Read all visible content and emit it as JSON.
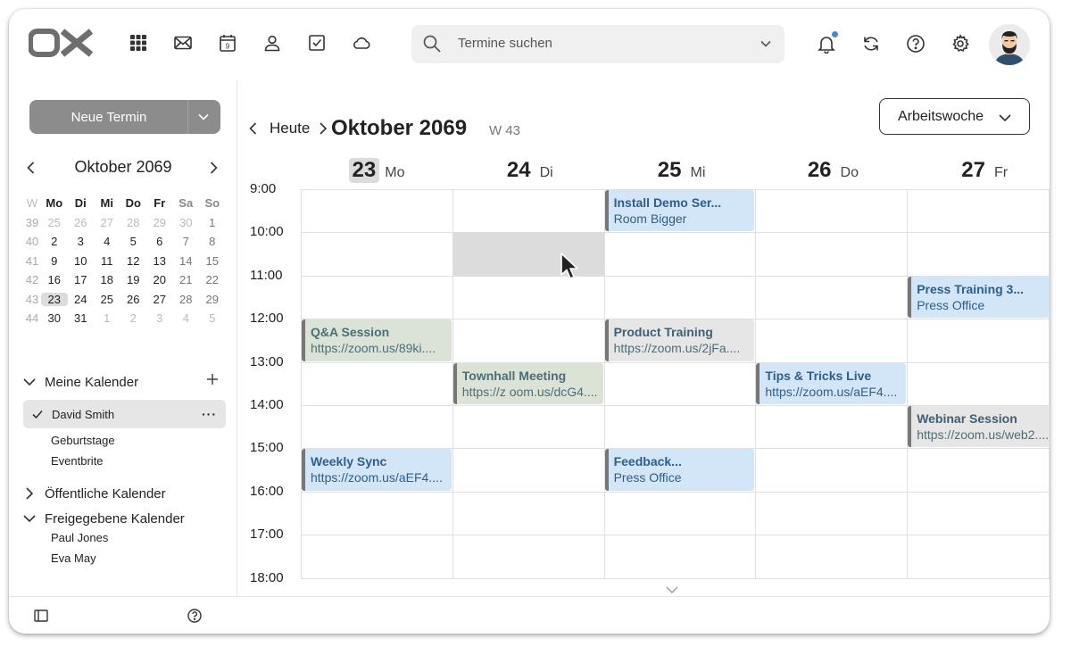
{
  "app": {
    "logo_text": "OX",
    "search": {
      "placeholder": "Termine suchen"
    },
    "apps": [
      "apps-grid-icon",
      "mail-icon",
      "calendar-icon",
      "contacts-icon",
      "tasks-icon",
      "drive-icon"
    ],
    "calendar_icon_day": "9",
    "right_icons": [
      "bell-icon",
      "refresh-icon",
      "help-icon",
      "gear-icon",
      "avatar"
    ],
    "notification_dot_color": "#3a8ee0"
  },
  "sidebar": {
    "new_button_label": "Neue Termin",
    "mini_calendar": {
      "title": "Oktober 2069",
      "week_header": "W",
      "weekday_headers": [
        "Mo",
        "Di",
        "Mi",
        "Do",
        "Fr",
        "Sa",
        "So"
      ],
      "weeks": [
        {
          "wk": "39",
          "days": [
            "25",
            "26",
            "27",
            "28",
            "29",
            "30",
            "1"
          ]
        },
        {
          "wk": "40",
          "days": [
            "2",
            "3",
            "4",
            "5",
            "6",
            "7",
            "8"
          ]
        },
        {
          "wk": "41",
          "days": [
            "9",
            "10",
            "11",
            "12",
            "13",
            "14",
            "15"
          ]
        },
        {
          "wk": "42",
          "days": [
            "16",
            "17",
            "18",
            "19",
            "20",
            "21",
            "22"
          ]
        },
        {
          "wk": "43",
          "days": [
            "23",
            "24",
            "25",
            "26",
            "27",
            "28",
            "29"
          ]
        },
        {
          "wk": "44",
          "days": [
            "30",
            "31",
            "1",
            "2",
            "3",
            "4",
            "5"
          ]
        }
      ],
      "today": "23"
    },
    "my_calendars_label": "Meine Kalender",
    "active_calendar": "David Smith",
    "my_calendars_items": [
      "Geburtstage",
      "Eventbrite"
    ],
    "public_calendars_label": "Öffentliche Kalender",
    "shared_calendars_label": "Freigegebene Kalender",
    "shared_items": [
      "Paul Jones",
      "Eva May"
    ]
  },
  "main": {
    "today_label": "Heute",
    "month_title": "Oktober 2069",
    "week_label": "W 43",
    "view_label": "Arbeitswoche",
    "days": [
      {
        "num": "23",
        "name": "Mo",
        "today": true
      },
      {
        "num": "24",
        "name": "Di",
        "today": false
      },
      {
        "num": "25",
        "name": "Mi",
        "today": false
      },
      {
        "num": "26",
        "name": "Do",
        "today": false
      },
      {
        "num": "27",
        "name": "Fr",
        "today": false
      }
    ],
    "times": [
      "9:00",
      "10:00",
      "11:00",
      "12:00",
      "13:00",
      "14:00",
      "15:00",
      "16:00",
      "17:00",
      "18:00"
    ],
    "selected_slot": {
      "day": 1,
      "start": "10:00",
      "end": "11:00"
    },
    "events": [
      {
        "title": "Install Demo Ser...",
        "subtitle": "Room Bigger",
        "day": 2,
        "start": 9,
        "end": 10,
        "color": "blue"
      },
      {
        "title": "Press Training 3...",
        "subtitle": "Press Office",
        "day": 4,
        "start": 11,
        "end": 12,
        "color": "blue"
      },
      {
        "title": "Q&A Session",
        "subtitle": "https://zoom.us/89ki....",
        "day": 0,
        "start": 12,
        "end": 13,
        "color": "green"
      },
      {
        "title": "Product Training",
        "subtitle": "https://zoom.us/2jFa....",
        "day": 2,
        "start": 12,
        "end": 13,
        "color": "gray"
      },
      {
        "title": "Townhall Meeting",
        "subtitle": "https://z oom.us/dcG4....",
        "day": 1,
        "start": 13,
        "end": 14,
        "color": "green"
      },
      {
        "title": "Tips & Tricks Live",
        "subtitle": "https://zoom.us/aEF4....",
        "day": 3,
        "start": 13,
        "end": 14,
        "color": "blue"
      },
      {
        "title": "Webinar Session",
        "subtitle": "https://zoom.us/web2....",
        "day": 4,
        "start": 14,
        "end": 15,
        "color": "gray"
      },
      {
        "title": "Weekly Sync",
        "subtitle": "https://zoom.us/aEF4....",
        "day": 0,
        "start": 15,
        "end": 16,
        "color": "blue"
      },
      {
        "title": "Feedback...",
        "subtitle": "Press Office",
        "day": 2,
        "start": 15,
        "end": 16,
        "color": "blue"
      }
    ]
  }
}
